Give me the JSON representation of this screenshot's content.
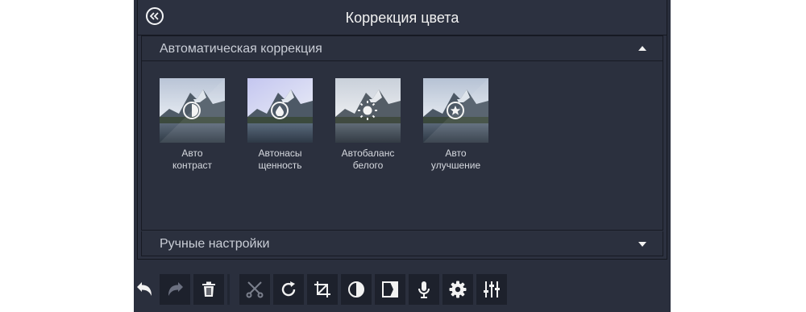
{
  "header": {
    "title": "Коррекция цвета",
    "back_icon": "double-chevron-left-icon"
  },
  "auto_section": {
    "title": "Автоматическая коррекция",
    "toggle_icon": "caret-up-icon",
    "tiles": [
      {
        "label_line1": "Авто",
        "label_line2": "контраст",
        "icon": "contrast-icon"
      },
      {
        "label_line1": "Автонасы",
        "label_line2": "щенность",
        "icon": "droplet-icon"
      },
      {
        "label_line1": "Автобаланс",
        "label_line2": "белого",
        "icon": "sun-icon"
      },
      {
        "label_line1": "Авто",
        "label_line2": "улучшение",
        "icon": "star-icon"
      }
    ]
  },
  "manual_section": {
    "title": "Ручные настройки",
    "toggle_icon": "caret-down-icon"
  },
  "toolbar": {
    "tools": [
      "undo-icon",
      "redo-icon",
      "trash-icon",
      "scissors-icon",
      "rotate-icon",
      "crop-icon",
      "color-adjust-icon",
      "transition-icon",
      "microphone-icon",
      "gear-icon",
      "sliders-icon"
    ]
  },
  "colors": {
    "panel_bg": "#2b303e",
    "toolbar_bg": "#1d212c",
    "text": "#f2f2f2",
    "accent": "#c9cdd6"
  }
}
